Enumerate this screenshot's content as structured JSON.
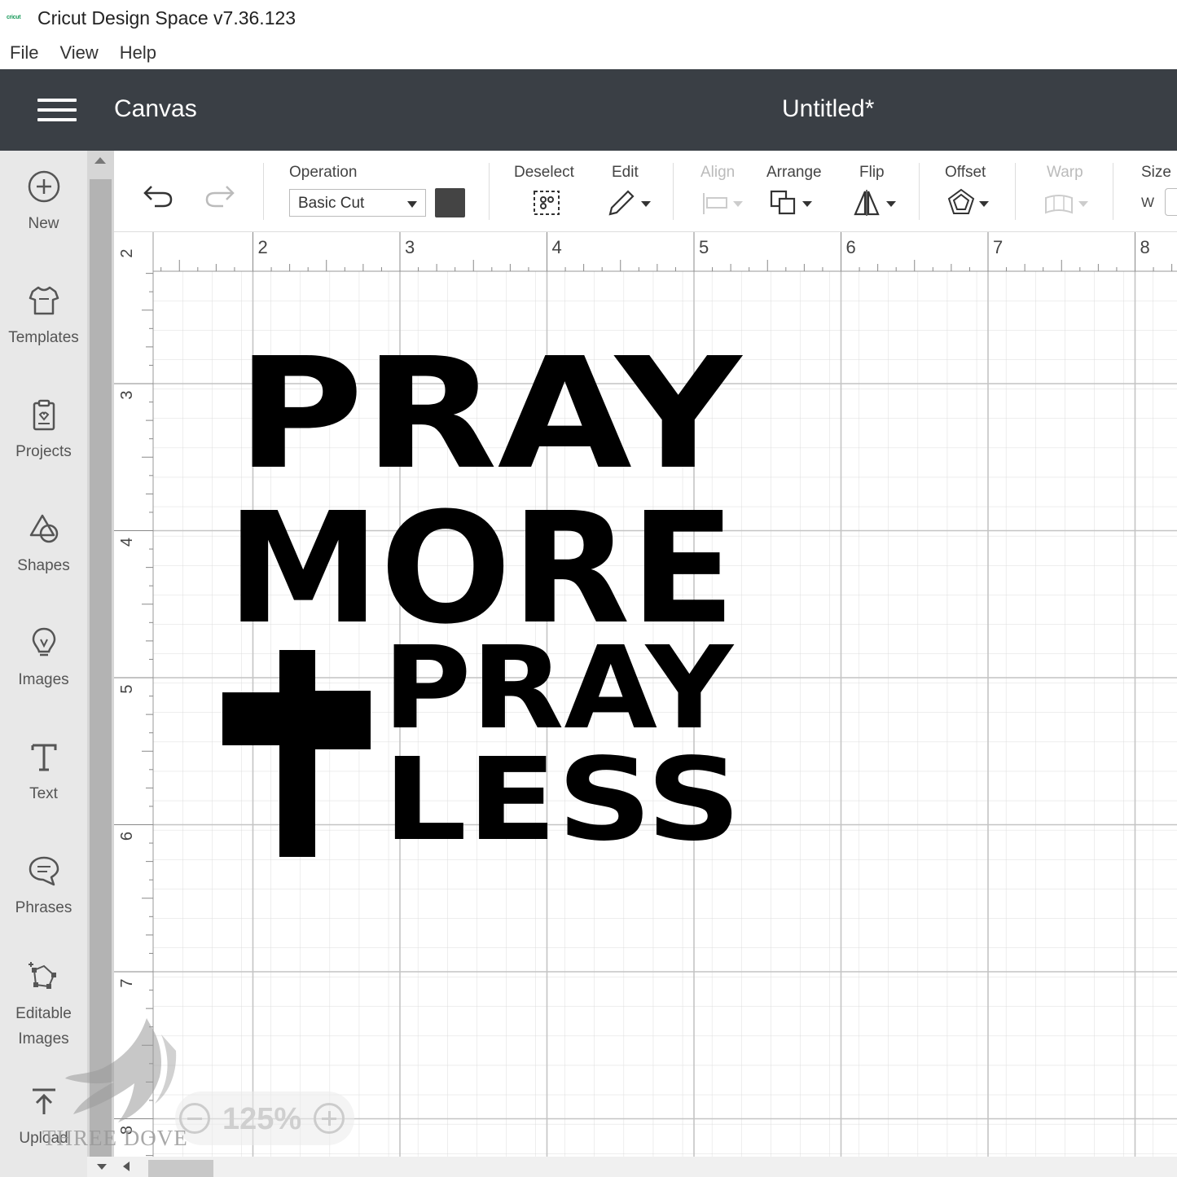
{
  "window": {
    "title": "Cricut Design Space  v7.36.123",
    "logo_text": "cricut"
  },
  "menubar": {
    "items": [
      "File",
      "View",
      "Help"
    ]
  },
  "header": {
    "section": "Canvas",
    "document_title": "Untitled*"
  },
  "sidebar": {
    "items": [
      {
        "label": "New",
        "icon": "plus-circle-icon"
      },
      {
        "label": "Templates",
        "icon": "tshirt-icon"
      },
      {
        "label": "Projects",
        "icon": "clipboard-icon"
      },
      {
        "label": "Shapes",
        "icon": "shapes-icon"
      },
      {
        "label": "Images",
        "icon": "lightbulb-icon"
      },
      {
        "label": "Text",
        "icon": "text-icon"
      },
      {
        "label": "Phrases",
        "icon": "speech-bubble-icon"
      },
      {
        "label": "Editable Images",
        "icon": "editable-images-icon"
      },
      {
        "label": "Upload",
        "icon": "upload-icon"
      }
    ]
  },
  "toolbar": {
    "operation_label": "Operation",
    "operation_value": "Basic Cut",
    "color": "#444444",
    "deselect_label": "Deselect",
    "edit_label": "Edit",
    "align_label": "Align",
    "arrange_label": "Arrange",
    "flip_label": "Flip",
    "offset_label": "Offset",
    "warp_label": "Warp",
    "size_label": "Size",
    "size_w_label": "W"
  },
  "ruler": {
    "top": [
      "2",
      "2",
      "3",
      "4",
      "5",
      "6",
      "7",
      "8"
    ],
    "left": [
      "3",
      "4",
      "5",
      "6",
      "7",
      "8"
    ]
  },
  "design": {
    "line1": "PRAY",
    "line2": "MORE",
    "line3": "PRAY",
    "line4": "LESS"
  },
  "zoom": {
    "value": "125%"
  },
  "watermark": {
    "text": "THREE DOVE"
  }
}
